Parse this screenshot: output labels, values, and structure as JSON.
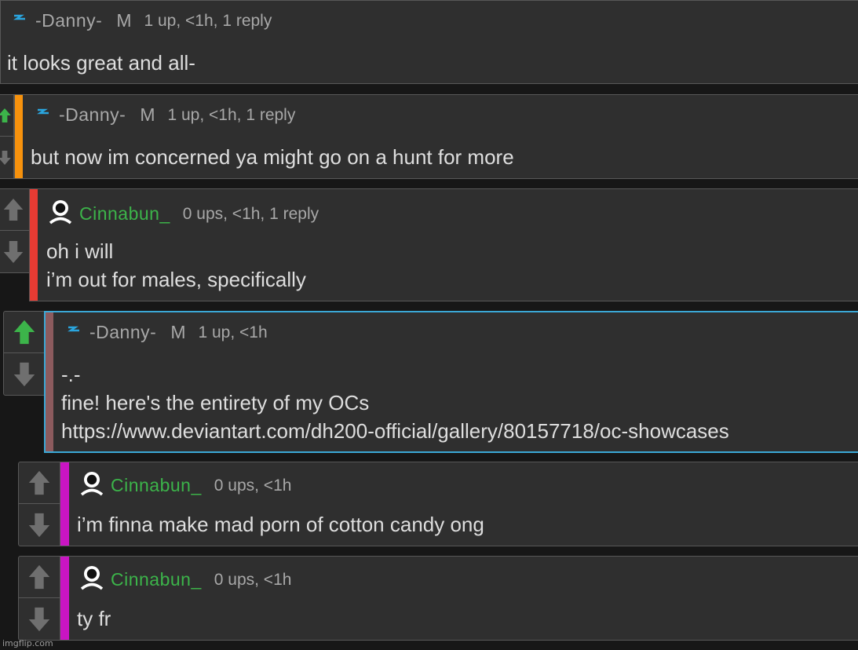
{
  "colors": {
    "background": "#171717",
    "panel": "#2f2f2f",
    "border": "#585858",
    "highlight_border": "#3ba8d6",
    "username_default": "#a8a8a8",
    "username_green": "#3cb44a",
    "upvote_active": "#3cb44a",
    "thread_orange": "#f7920d",
    "thread_red": "#e83b33",
    "thread_maroon": "#8c5b5e",
    "thread_magenta": "#c915c3"
  },
  "comments": [
    {
      "username": "-Danny-",
      "gender": "M",
      "meta": "1 up, <1h, 1 reply",
      "avatar": "lightning-bolt-icon",
      "lines": [
        "it looks great and all-"
      ]
    },
    {
      "username": "-Danny-",
      "gender": "M",
      "meta": "1 up, <1h, 1 reply",
      "avatar": "lightning-bolt-icon",
      "lines": [
        "but now im concerned ya might go on a hunt for more"
      ]
    },
    {
      "username": "Cinnabun_",
      "meta": "0 ups, <1h, 1 reply",
      "avatar": "user-icon",
      "lines": [
        "oh i will",
        "i’m out for males, specifically"
      ]
    },
    {
      "username": "-Danny-",
      "gender": "M",
      "meta": "1 up, <1h",
      "avatar": "lightning-bolt-icon",
      "upvoted": true,
      "lines": [
        "-.-",
        "fine! here's the entirety of my OCs",
        "https://www.deviantart.com/dh200-official/gallery/80157718/oc-showcases"
      ]
    },
    {
      "username": "Cinnabun_",
      "meta": "0 ups, <1h",
      "avatar": "user-icon",
      "lines": [
        "i’m finna make mad porn of cotton candy ong"
      ]
    },
    {
      "username": "Cinnabun_",
      "meta": "0 ups, <1h",
      "avatar": "user-icon",
      "lines": [
        "ty fr"
      ]
    }
  ],
  "watermark": "imgflip.com"
}
